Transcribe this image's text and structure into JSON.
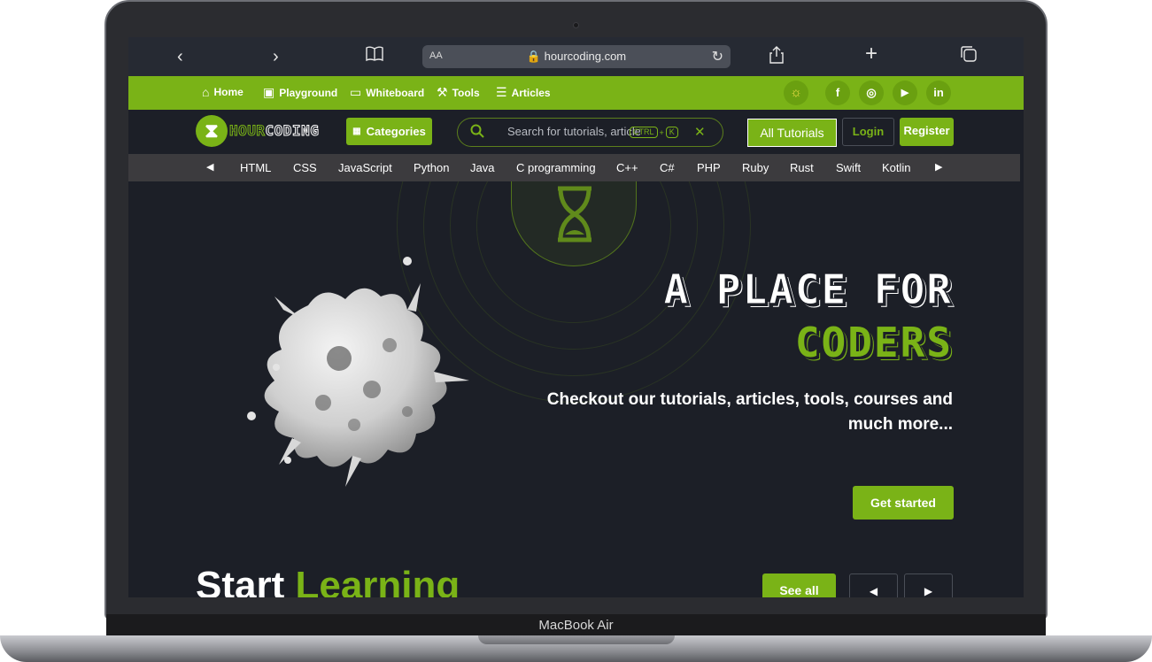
{
  "browser": {
    "url_aa": "AA",
    "url": "🔒 hourcoding.com"
  },
  "topnav": {
    "items": [
      {
        "icon": "⌂",
        "label": "Home"
      },
      {
        "icon": "▣",
        "label": "Playground"
      },
      {
        "icon": "▭",
        "label": "Whiteboard"
      },
      {
        "icon": "⚒",
        "label": "Tools"
      },
      {
        "icon": "☰",
        "label": "Articles"
      }
    ],
    "social": {
      "sun": "☼",
      "facebook": "f",
      "instagram": "◎",
      "youtube": "▶",
      "linkedin": "in"
    }
  },
  "header": {
    "logo_hour": "HOUR",
    "logo_coding": "CODING",
    "categories_label": "Categories",
    "search_placeholder": "Search for tutorials, articles...",
    "kbd_ctrl": "CTRL",
    "kbd_plus": "+",
    "kbd_k": "K",
    "all_tutorials": "All Tutorials",
    "login": "Login",
    "register": "Register"
  },
  "languages": [
    "HTML",
    "CSS",
    "JavaScript",
    "Python",
    "Java",
    "C programming",
    "C++",
    "C#",
    "PHP",
    "Ruby",
    "Rust",
    "Swift",
    "Kotlin"
  ],
  "hero": {
    "title_line1": "A PLACE FOR",
    "title_line2": "CODERS",
    "subtitle": "Checkout our tutorials, articles, tools, courses and much more...",
    "cta": "Get started"
  },
  "learning": {
    "title_start": "Start",
    "title_accent": "Learning",
    "see_all": "See all"
  },
  "device": {
    "label": "MacBook Air"
  },
  "colors": {
    "accent": "#7ab317",
    "background": "#1c1f27",
    "strip": "#3c3b3e"
  }
}
